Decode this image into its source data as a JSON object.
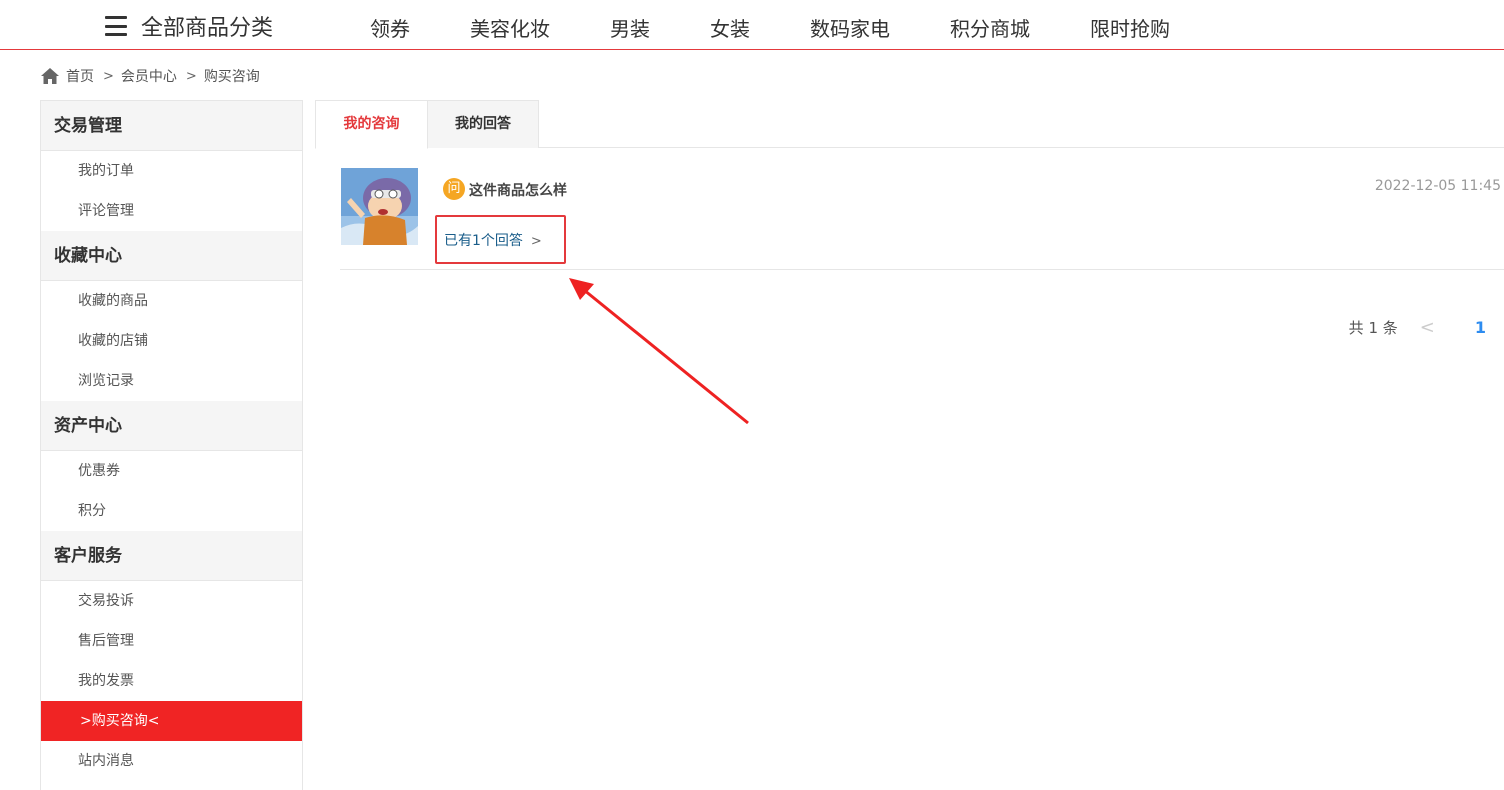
{
  "topnav": {
    "category_label": "全部商品分类",
    "items": [
      "领券",
      "美容化妆",
      "男装",
      "女装",
      "数码家电",
      "积分商城",
      "限时抢购"
    ]
  },
  "breadcrumb": {
    "home": "首页",
    "sep": ">",
    "level2": "会员中心",
    "level3": "购买咨询"
  },
  "sidebar": {
    "groups": [
      {
        "title": "交易管理",
        "items": [
          "我的订单",
          "评论管理"
        ]
      },
      {
        "title": "收藏中心",
        "items": [
          "收藏的商品",
          "收藏的店铺",
          "浏览记录"
        ]
      },
      {
        "title": "资产中心",
        "items": [
          "优惠券",
          "积分"
        ]
      },
      {
        "title": "客户服务",
        "items": [
          "交易投诉",
          "售后管理",
          "我的发票",
          ">购买咨询<",
          "站内消息"
        ]
      }
    ]
  },
  "tabs": [
    "我的咨询",
    "我的回答"
  ],
  "question": {
    "icon_char": "问",
    "text": "这件商品怎么样",
    "time": "2022-12-05 11:45",
    "answers_link": "已有1个回答",
    "chevron": ">"
  },
  "pager": {
    "total": "共 1 条",
    "prev": "<",
    "current": "1"
  },
  "colors": {
    "accent": "#e4393c",
    "active_bg": "#f02424",
    "question_icon": "#f5a623",
    "page_link": "#2d8cf0"
  }
}
